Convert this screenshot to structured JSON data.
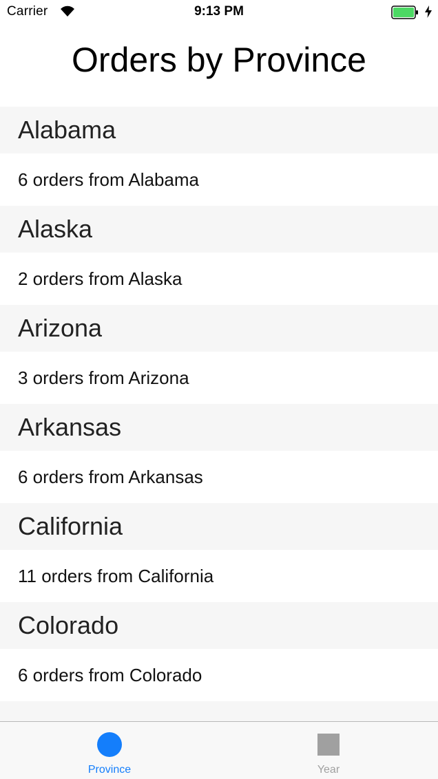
{
  "status_bar": {
    "carrier": "Carrier",
    "time": "9:13 PM",
    "icons": [
      "wifi-icon",
      "battery-icon",
      "charging-bolt-icon"
    ],
    "battery_color": "#4cd964"
  },
  "page": {
    "title": "Orders by Province"
  },
  "sections": [
    {
      "header": "Alabama",
      "row": "6 orders from Alabama"
    },
    {
      "header": "Alaska",
      "row": "2 orders from Alaska"
    },
    {
      "header": "Arizona",
      "row": "3 orders from Arizona"
    },
    {
      "header": "Arkansas",
      "row": "6 orders from Arkansas"
    },
    {
      "header": "California",
      "row": "11 orders from California"
    },
    {
      "header": "Colorado",
      "row": "6 orders from Colorado"
    }
  ],
  "tab_bar": {
    "tabs": [
      {
        "label": "Province",
        "icon": "circle-icon",
        "selected": true
      },
      {
        "label": "Year",
        "icon": "square-icon",
        "selected": false
      }
    ],
    "selected_color": "#147efb",
    "unselected_color": "#a0a0a0"
  }
}
